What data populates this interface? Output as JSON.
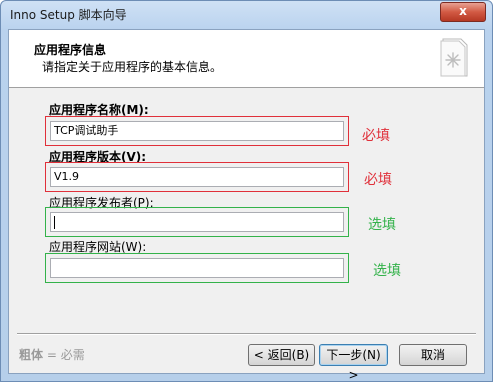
{
  "window": {
    "title": "Inno Setup 脚本向导",
    "close_glyph": "x"
  },
  "header": {
    "title": "应用程序信息",
    "description": "请指定关于应用程序的基本信息。",
    "icon": "wizard-page-icon"
  },
  "fields": [
    {
      "label": "应用程序名称(M):",
      "value": "TCP调试助手",
      "annotation": "必填",
      "required": true
    },
    {
      "label": "应用程序版本(V):",
      "value": "V1.9",
      "annotation": "必填",
      "required": true
    },
    {
      "label": "应用程序发布者(P):",
      "value": "",
      "annotation": "选填",
      "required": false
    },
    {
      "label": "应用程序网站(W):",
      "value": "",
      "annotation": "选填",
      "required": false
    }
  ],
  "footer": {
    "legend_bold": "粗体",
    "legend_rest": " = 必需",
    "back_label": "< 返回(B)",
    "next_label": "下一步(N) >",
    "cancel_label": "取消"
  },
  "colors": {
    "required": "#e0303a",
    "optional": "#33b24a"
  }
}
